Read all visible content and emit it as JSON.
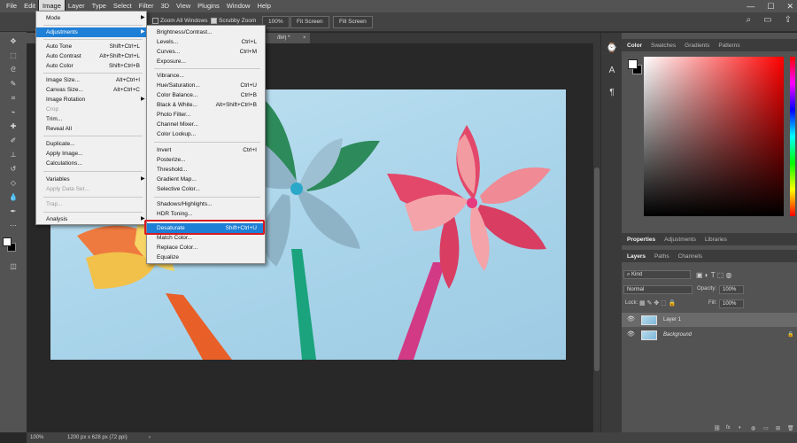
{
  "menubar": {
    "items": [
      "File",
      "Edit",
      "Image",
      "Layer",
      "Type",
      "Select",
      "Filter",
      "3D",
      "View",
      "Plugins",
      "Window",
      "Help"
    ],
    "controls": [
      "—",
      "☐",
      "✕"
    ]
  },
  "options": {
    "zoom_all_windows": "Zoom All Windows",
    "scrubby_zoom": "Scrubby Zoom",
    "zoom_value": "100%",
    "fit_screen": "Fit Screen",
    "fill_screen": "Fill Screen"
  },
  "doc_tab": {
    "title": "/8#) *",
    "close": "×"
  },
  "status": {
    "zoom": "100%",
    "size": "1200 px x 628 px (72 ppi)",
    "arrow": "›"
  },
  "image_menu": [
    {
      "label": "Mode",
      "submenu": true
    },
    {
      "label": "Adjustments",
      "submenu": true,
      "highlight": true
    },
    {
      "label": "Auto Tone",
      "shortcut": "Shift+Ctrl+L"
    },
    {
      "label": "Auto Contrast",
      "shortcut": "Alt+Shift+Ctrl+L"
    },
    {
      "label": "Auto Color",
      "shortcut": "Shift+Ctrl+B"
    },
    {
      "label": "Image Size...",
      "shortcut": "Alt+Ctrl+I"
    },
    {
      "label": "Canvas Size...",
      "shortcut": "Alt+Ctrl+C"
    },
    {
      "label": "Image Rotation",
      "submenu": true
    },
    {
      "label": "Crop",
      "disabled": true
    },
    {
      "label": "Trim..."
    },
    {
      "label": "Reveal All"
    },
    {
      "label": "Duplicate..."
    },
    {
      "label": "Apply Image..."
    },
    {
      "label": "Calculations..."
    },
    {
      "label": "Variables",
      "submenu": true
    },
    {
      "label": "Apply Data Set...",
      "disabled": true
    },
    {
      "label": "Trap...",
      "disabled": true
    },
    {
      "label": "Analysis",
      "submenu": true
    }
  ],
  "adjust_menu": [
    {
      "label": "Brightness/Contrast..."
    },
    {
      "label": "Levels...",
      "shortcut": "Ctrl+L"
    },
    {
      "label": "Curves...",
      "shortcut": "Ctrl+M"
    },
    {
      "label": "Exposure..."
    },
    {
      "label": "Vibrance..."
    },
    {
      "label": "Hue/Saturation...",
      "shortcut": "Ctrl+U"
    },
    {
      "label": "Color Balance...",
      "shortcut": "Ctrl+B"
    },
    {
      "label": "Black & White...",
      "shortcut": "Alt+Shift+Ctrl+B"
    },
    {
      "label": "Photo Filter..."
    },
    {
      "label": "Channel Mixer..."
    },
    {
      "label": "Color Lookup..."
    },
    {
      "label": "Invert",
      "shortcut": "Ctrl+I"
    },
    {
      "label": "Posterize..."
    },
    {
      "label": "Threshold..."
    },
    {
      "label": "Gradient Map..."
    },
    {
      "label": "Selective Color..."
    },
    {
      "label": "Shadows/Highlights..."
    },
    {
      "label": "HDR Toning..."
    },
    {
      "label": "Desaturate",
      "shortcut": "Shift+Ctrl+U",
      "highlight": true
    },
    {
      "label": "Match Color..."
    },
    {
      "label": "Replace Color..."
    },
    {
      "label": "Equalize"
    }
  ],
  "panels": {
    "color_tabs": [
      "Color",
      "Swatches",
      "Gradients",
      "Patterns"
    ],
    "props_tabs": [
      "Properties",
      "Adjustments",
      "Libraries"
    ],
    "layer_tabs": [
      "Layers",
      "Paths",
      "Channels"
    ],
    "kind": "Kind",
    "blend_mode": "Normal",
    "opacity_label": "Opacity:",
    "opacity_value": "100%",
    "lock_label": "Lock:",
    "fill_label": "Fill:",
    "fill_value": "100%",
    "layers": [
      {
        "name": "Layer 1",
        "selected": true
      },
      {
        "name": "Background",
        "italic": true,
        "locked": true
      }
    ],
    "bottom_icons": [
      "⛓",
      "fx",
      "◐",
      "◍",
      "▭",
      "⊞",
      "🗑"
    ]
  },
  "colors": {
    "highlight": "#1e7fd6",
    "annotation": "#d71920"
  }
}
